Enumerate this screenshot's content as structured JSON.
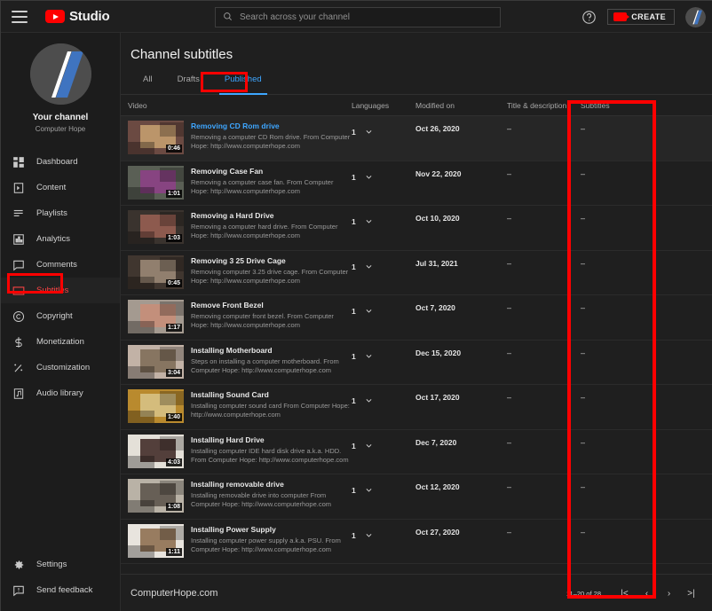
{
  "topbar": {
    "menu_icon": "hamburger-icon",
    "logo_text": "Studio",
    "search_placeholder": "Search across your channel",
    "search_value": "",
    "search_icon": "search-icon",
    "help_icon": "help-circle-icon",
    "create_label": "CREATE",
    "create_icon": "video-camera-icon",
    "avatar": "channel-avatar"
  },
  "sidebar": {
    "channel_name": "Your channel",
    "channel_subtitle": "Computer Hope",
    "items": [
      {
        "label": "Dashboard",
        "icon": "dashboard-icon"
      },
      {
        "label": "Content",
        "icon": "content-icon"
      },
      {
        "label": "Playlists",
        "icon": "playlists-icon"
      },
      {
        "label": "Analytics",
        "icon": "analytics-icon"
      },
      {
        "label": "Comments",
        "icon": "comments-icon"
      },
      {
        "label": "Subtitles",
        "icon": "subtitles-icon"
      },
      {
        "label": "Copyright",
        "icon": "copyright-icon"
      },
      {
        "label": "Monetization",
        "icon": "dollar-icon"
      },
      {
        "label": "Customization",
        "icon": "magic-wand-icon"
      },
      {
        "label": "Audio library",
        "icon": "audio-library-icon"
      }
    ],
    "active_item": "Subtitles",
    "bottom_items": [
      {
        "label": "Settings",
        "icon": "gear-icon"
      },
      {
        "label": "Send feedback",
        "icon": "feedback-icon"
      }
    ]
  },
  "main": {
    "page_title": "Channel subtitles",
    "tabs": [
      {
        "label": "All"
      },
      {
        "label": "Drafts"
      },
      {
        "label": "Published"
      }
    ],
    "active_tab": "Published",
    "columns": [
      "Video",
      "Languages",
      "Modified on",
      "Title & description",
      "Subtitles"
    ],
    "rows": [
      {
        "title": "Removing CD Rom drive",
        "description": "Removing a computer CD Rom drive. From Computer Hope: http://www.computerhope.com",
        "duration": "0:46",
        "languages": "1",
        "modified": "Oct 26, 2020",
        "title_desc": "–",
        "subtitles": "–",
        "thumb_a": "#6b4a42",
        "thumb_b": "#c9a271",
        "hovered": true
      },
      {
        "title": "Removing Case Fan",
        "description": "Removing a computer case fan. From Computer Hope: http://www.computerhope.com",
        "duration": "1:01",
        "languages": "1",
        "modified": "Nov 22, 2020",
        "title_desc": "–",
        "subtitles": "–",
        "thumb_a": "#5a5f55",
        "thumb_b": "#8f3f8a",
        "hovered": false
      },
      {
        "title": "Removing a Hard Drive",
        "description": "Removing a computer hard drive. From Computer Hope: http://www.computerhope.com",
        "duration": "1:03",
        "languages": "1",
        "modified": "Oct 10, 2020",
        "title_desc": "–",
        "subtitles": "–",
        "thumb_a": "#3a332e",
        "thumb_b": "#9c6154",
        "hovered": false
      },
      {
        "title": "Removing 3 25 Drive Cage",
        "description": "Removing computer 3.25 drive cage. From Computer Hope: http://www.computerhope.com",
        "duration": "0:45",
        "languages": "1",
        "modified": "Jul 31, 2021",
        "title_desc": "–",
        "subtitles": "–",
        "thumb_a": "#40362f",
        "thumb_b": "#a08c79",
        "hovered": false
      },
      {
        "title": "Remove Front Bezel",
        "description": "Removing computer front bezel. From Computer Hope: http://www.computerhope.com",
        "duration": "1:17",
        "languages": "1",
        "modified": "Oct 7, 2020",
        "title_desc": "–",
        "subtitles": "–",
        "thumb_a": "#a49a90",
        "thumb_b": "#c98d78",
        "hovered": false
      },
      {
        "title": "Installing Motherboard",
        "description": "Steps on installing a computer motherboard. From Computer Hope: http://www.computerhope.com",
        "duration": "3:04",
        "languages": "1",
        "modified": "Dec 15, 2020",
        "title_desc": "–",
        "subtitles": "–",
        "thumb_a": "#c2b2a6",
        "thumb_b": "#7d6a55",
        "hovered": false
      },
      {
        "title": "Installing Sound Card",
        "description": "Installing computer sound card From Computer Hope: http://www.computerhope.com",
        "duration": "1:40",
        "languages": "1",
        "modified": "Oct 17, 2020",
        "title_desc": "–",
        "subtitles": "–",
        "thumb_a": "#b98a2e",
        "thumb_b": "#d8c48a",
        "hovered": false
      },
      {
        "title": "Installing Hard Drive",
        "description": "Installing computer IDE hard disk drive a.k.a. HDD. From Computer Hope: http://www.computerhope.com",
        "duration": "4:03",
        "languages": "1",
        "modified": "Dec 7, 2020",
        "title_desc": "–",
        "subtitles": "–",
        "thumb_a": "#e4e0d8",
        "thumb_b": "#3a2220",
        "hovered": false
      },
      {
        "title": "Installing removable drive",
        "description": "Installing removable drive into computer From Computer Hope: http://www.computerhope.com",
        "duration": "1:08",
        "languages": "1",
        "modified": "Oct 12, 2020",
        "title_desc": "–",
        "subtitles": "–",
        "thumb_a": "#b9b2a6",
        "thumb_b": "#585048",
        "hovered": false
      },
      {
        "title": "Installing Power Supply",
        "description": "Installing computer power supply a.k.a. PSU. From Computer Hope: http://www.computerhope.com",
        "duration": "1:11",
        "languages": "1",
        "modified": "Oct 27, 2020",
        "title_desc": "–",
        "subtitles": "–",
        "thumb_a": "#e8e4de",
        "thumb_b": "#8a6a4a",
        "hovered": false
      }
    ]
  },
  "footer": {
    "brand": "ComputerHope.com",
    "range": "11–20 of 28",
    "first_label": "|<",
    "prev_label": "‹",
    "next_label": "›",
    "last_label": ">|"
  },
  "annotations": {
    "accent_red": "#ff0000",
    "accent_blue": "#3ea6ff"
  }
}
